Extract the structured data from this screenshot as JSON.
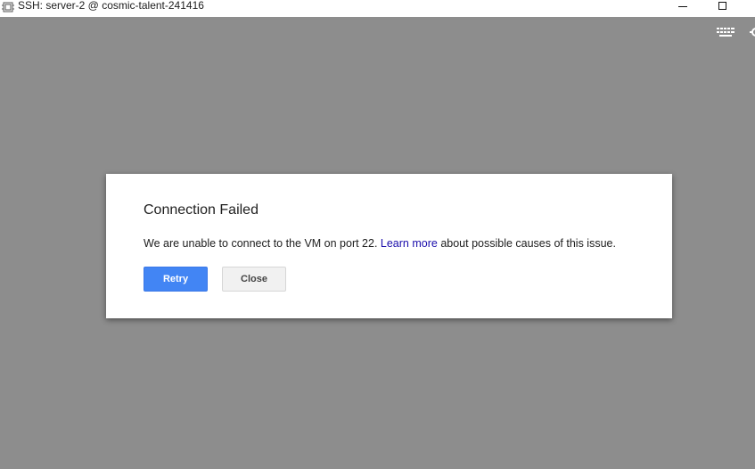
{
  "window": {
    "title": "SSH: server-2 @ cosmic-talent-241416",
    "background_color": "#8d8d8d"
  },
  "toolbar": {
    "icons": [
      "keyboard-icon",
      "gear-icon"
    ]
  },
  "dialog": {
    "title": "Connection Failed",
    "message_before": "We are unable to connect to the VM on port 22. ",
    "link_text": "Learn more",
    "message_after": " about possible causes of this issue.",
    "retry_label": "Retry",
    "close_label": "Close",
    "link_color": "#1a0dab",
    "primary_color": "#4285f4"
  }
}
